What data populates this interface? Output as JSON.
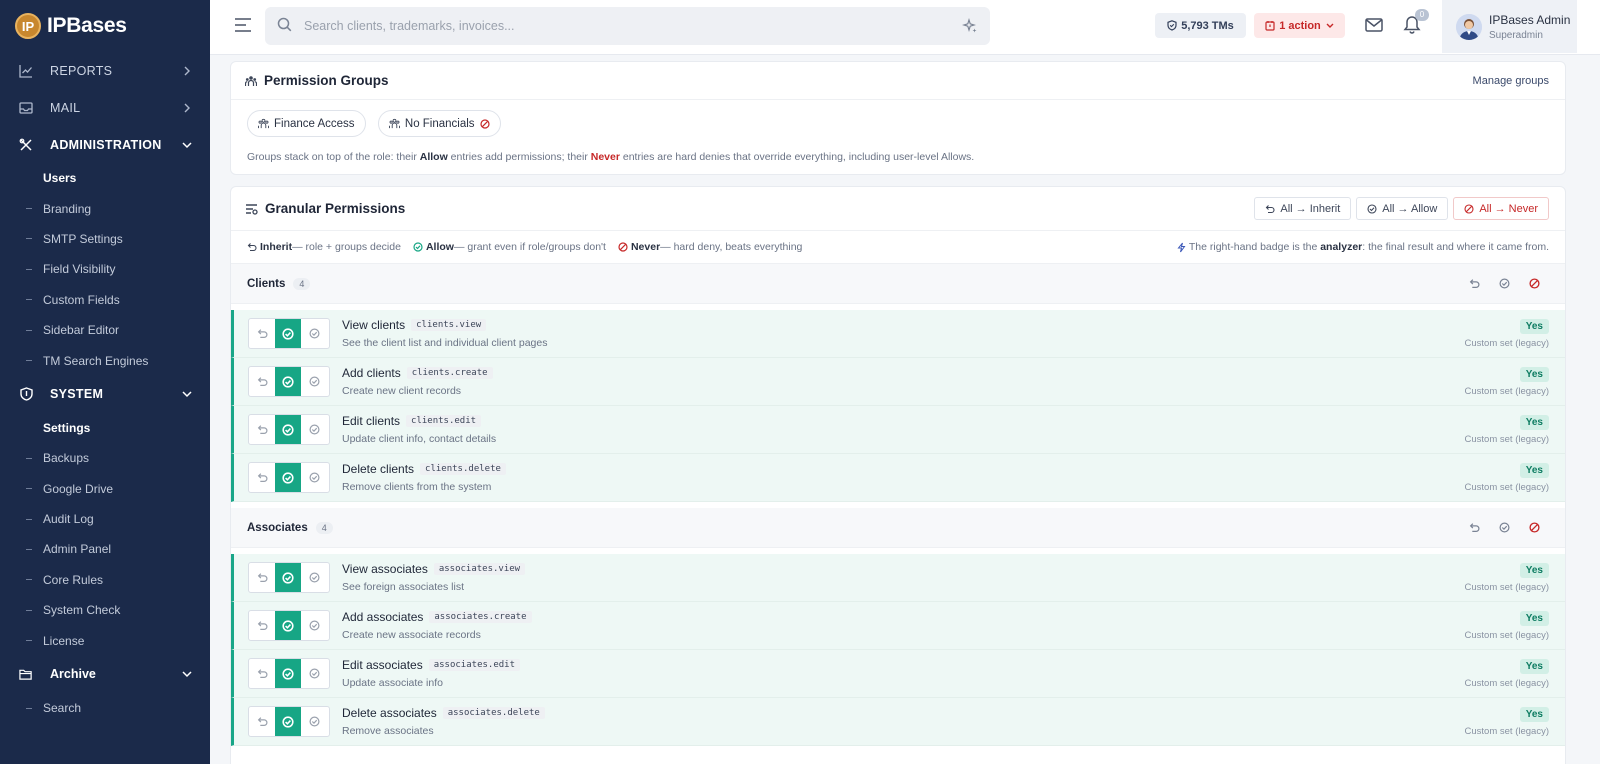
{
  "brand": {
    "logo_letters": "IP",
    "name": "IPBases"
  },
  "sidebar": {
    "reports": "REPORTS",
    "mail": "MAIL",
    "administration": "ADMINISTRATION",
    "admin_items": [
      "Users",
      "Branding",
      "SMTP Settings",
      "Field Visibility",
      "Custom Fields",
      "Sidebar Editor",
      "TM Search Engines"
    ],
    "system": "SYSTEM",
    "system_items": [
      "Settings",
      "Backups",
      "Google Drive",
      "Audit Log",
      "Admin Panel",
      "Core Rules",
      "System Check",
      "License"
    ],
    "archive": "Archive",
    "archive_items": [
      "Search"
    ]
  },
  "topbar": {
    "search_placeholder": "Search clients, trademarks, invoices...",
    "tm_count": "5,793 TMs",
    "action": "1 action",
    "bell_count": "0",
    "user_name": "IPBases Admin",
    "user_role": "Superadmin"
  },
  "groups_card": {
    "title": "Permission Groups",
    "manage_link": "Manage groups",
    "chips": [
      "Finance Access",
      "No Financials"
    ],
    "note_before_allow": "Groups stack on top of the role: their ",
    "allow_word": "Allow",
    "note_middle": " entries add permissions; their ",
    "never_word": "Never",
    "note_after": " entries are hard denies that override everything, including user-level Allows."
  },
  "granular": {
    "title": "Granular Permissions",
    "btn_inherit": "All → Inherit",
    "btn_allow": "All → Allow",
    "btn_never": "All → Never",
    "legend": {
      "inherit_word": "Inherit",
      "inherit_text": " — role + groups decide",
      "allow_word": "Allow",
      "allow_text": " — grant even if role/groups don't",
      "never_word": "Never",
      "never_text": " — hard deny, beats everything",
      "analyzer_before": "The right-hand badge is the ",
      "analyzer_word": "analyzer",
      "analyzer_after": ": the final result and where it came from."
    },
    "groups": [
      {
        "name": "Clients",
        "count": "4",
        "perms": [
          {
            "name": "View clients",
            "code": "clients.view",
            "desc": "See the client list and individual client pages",
            "result": "Yes",
            "source": "Custom set (legacy)"
          },
          {
            "name": "Add clients",
            "code": "clients.create",
            "desc": "Create new client records",
            "result": "Yes",
            "source": "Custom set (legacy)"
          },
          {
            "name": "Edit clients",
            "code": "clients.edit",
            "desc": "Update client info, contact details",
            "result": "Yes",
            "source": "Custom set (legacy)"
          },
          {
            "name": "Delete clients",
            "code": "clients.delete",
            "desc": "Remove clients from the system",
            "result": "Yes",
            "source": "Custom set (legacy)"
          }
        ]
      },
      {
        "name": "Associates",
        "count": "4",
        "perms": [
          {
            "name": "View associates",
            "code": "associates.view",
            "desc": "See foreign associates list",
            "result": "Yes",
            "source": "Custom set (legacy)"
          },
          {
            "name": "Add associates",
            "code": "associates.create",
            "desc": "Create new associate records",
            "result": "Yes",
            "source": "Custom set (legacy)"
          },
          {
            "name": "Edit associates",
            "code": "associates.edit",
            "desc": "Update associate info",
            "result": "Yes",
            "source": "Custom set (legacy)"
          },
          {
            "name": "Delete associates",
            "code": "associates.delete",
            "desc": "Remove associates",
            "result": "Yes",
            "source": "Custom set (legacy)"
          }
        ]
      }
    ]
  }
}
